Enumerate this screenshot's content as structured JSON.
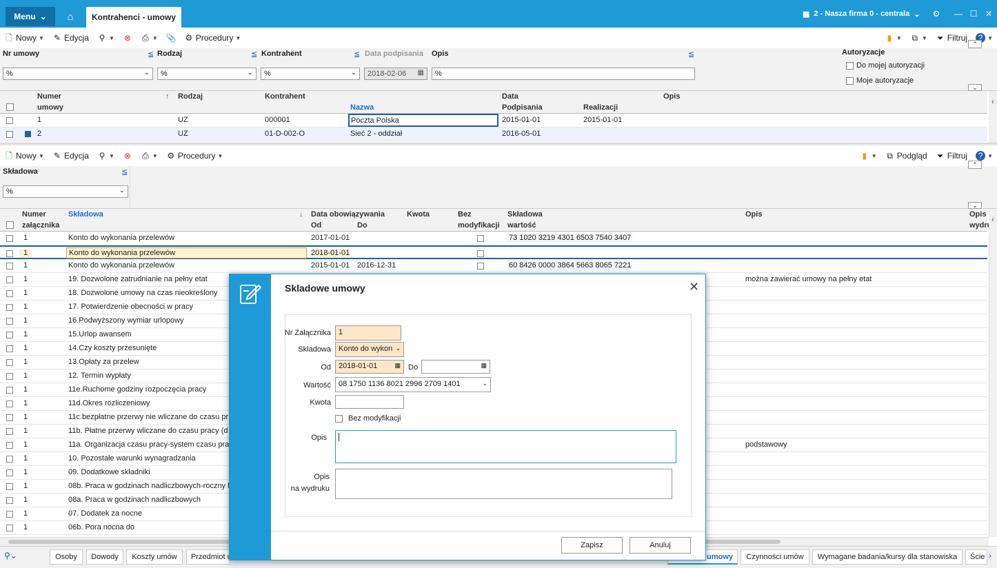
{
  "titlebar": {
    "menu_label": "Menu",
    "active_tab": "Kontrahenci - umowy",
    "company": "2 - Nasza firma 0 - centrala"
  },
  "toolbar1": {
    "new_label": "Nowy",
    "edit_label": "Edycja",
    "procedures_label": "Procedury",
    "filter_label": "Filtruj"
  },
  "filters1": {
    "nr_label": "Nr umowy",
    "rodzaj_label": "Rodzaj",
    "kontrahent_label": "Kontrahent",
    "data_label": "Data podpisania",
    "opis_label": "Opis",
    "nr_value": "%",
    "rodzaj_value": "%",
    "kontrahent_value": "%",
    "data_value": "2018-02-06",
    "opis_value": "%",
    "autoryzacje_label": "Autoryzacje",
    "do_mojej": "Do mojej autoryzacji",
    "moje": "Moje autoryzacje"
  },
  "grid1": {
    "h_numer": "Numer",
    "h_umowy": "umowy",
    "h_rodzaj": "Rodzaj",
    "h_kontrahent": "Kontrahent",
    "h_nazwa": "Nazwa",
    "h_data": "Data",
    "h_podpisania": "Podpisania",
    "h_realizacji": "Realizacji",
    "h_opis": "Opis",
    "rows": [
      {
        "numer": "1",
        "rodzaj": "UZ",
        "kontrahent": "000001",
        "nazwa": "Poczta Polska",
        "podpisania": "2015-01-01",
        "realizacji": "2015-01-01"
      },
      {
        "numer": "2",
        "rodzaj": "UZ",
        "kontrahent": "01-D-002-O",
        "nazwa": "Sieć 2 - oddział",
        "podpisania": "2016-05-01",
        "realizacji": ""
      }
    ]
  },
  "toolbar2": {
    "new_label": "Nowy",
    "edit_label": "Edycja",
    "procedures_label": "Procedury",
    "preview_label": "Podgląd",
    "filter_label": "Filtruj"
  },
  "filters2": {
    "skladowa_label": "Składowa",
    "skladowa_value": "%"
  },
  "grid2": {
    "h_numer": "Numer",
    "h_zalacznika": "załącznika",
    "h_skladowa": "Składowa",
    "h_data_obow": "Data obowiązywania",
    "h_od": "Od",
    "h_do": "Do",
    "h_kwota": "Kwota",
    "h_bez": "Bez",
    "h_modyfikacji": "modyfikacji",
    "h_skladowa2": "Składowa",
    "h_wartosc": "wartość",
    "h_opis": "Opis",
    "h_opis2": "Opis",
    "h_wydruk": "wydru",
    "rows": [
      {
        "numer": "1",
        "skladowa": "Konto do wykonania przelewów",
        "od": "2017-01-01",
        "do": "",
        "wartosc": "73 1020 3219 4301 6503 7540 3407",
        "opis": "",
        "bezcb": true
      },
      {
        "numer": "1",
        "skladowa": "Konto do wykonania przelewów",
        "od": "2018-01-01",
        "do": "",
        "wartosc": "",
        "opis": "",
        "bezcb": true
      },
      {
        "numer": "1",
        "skladowa": "Konto do wykonania przelewów",
        "od": "2015-01-01",
        "do": "2016-12-31",
        "wartosc": "60 8426 0000 3864 5663 8065 7221",
        "opis": "",
        "bezcb": true
      },
      {
        "numer": "1",
        "skladowa": "19. Dozwolone zatrudnianie na pełny etat",
        "od": "",
        "do": "",
        "wartosc": "",
        "opis": "można zawierać umowy na pełny etat",
        "bezcb": false
      },
      {
        "numer": "1",
        "skladowa": "18. Dozwolone umowy na czas nieokreślony",
        "od": "",
        "do": "",
        "wartosc": "",
        "opis": "",
        "bezcb": false
      },
      {
        "numer": "1",
        "skladowa": "17. Potwierdzenie obecności w pracy",
        "od": "",
        "do": "",
        "wartosc": "",
        "opis": "",
        "bezcb": false
      },
      {
        "numer": "1",
        "skladowa": "16.Podwyższony wymiar urlopowy",
        "od": "",
        "do": "",
        "wartosc": "",
        "opis": "",
        "bezcb": false
      },
      {
        "numer": "1",
        "skladowa": "15.Urlop awansem",
        "od": "",
        "do": "",
        "wartosc": "",
        "opis": "",
        "bezcb": false
      },
      {
        "numer": "1",
        "skladowa": "14.Czy koszty przesunięte",
        "od": "",
        "do": "",
        "wartosc": "",
        "opis": "",
        "bezcb": false
      },
      {
        "numer": "1",
        "skladowa": "13.Opłaty za przelew",
        "od": "",
        "do": "",
        "wartosc": "",
        "opis": "",
        "bezcb": false
      },
      {
        "numer": "1",
        "skladowa": "12. Termin wypłaty",
        "od": "",
        "do": "",
        "wartosc": "",
        "opis": "",
        "bezcb": false
      },
      {
        "numer": "1",
        "skladowa": "11e.Ruchome godziny rozpoczęcia pracy",
        "od": "",
        "do": "",
        "wartosc": "",
        "opis": "",
        "bezcb": false
      },
      {
        "numer": "1",
        "skladowa": "11d.Okres rozliczeniowy",
        "od": "",
        "do": "",
        "wartosc": "",
        "opis": "",
        "bezcb": false
      },
      {
        "numer": "1",
        "skladowa": "11c.bezpłatne przerwy nie wliczane do czasu pr",
        "od": "",
        "do": "",
        "wartosc": "",
        "opis": "",
        "bezcb": false
      },
      {
        "numer": "1",
        "skladowa": "11b. Płatne przerwy wliczane do czasu pracy (d",
        "od": "",
        "do": "",
        "wartosc": "",
        "opis": "",
        "bezcb": false
      },
      {
        "numer": "1",
        "skladowa": "11a. Organizacja czasu pracy-system czasu prac",
        "od": "",
        "do": "",
        "wartosc": "",
        "opis": "podstawowy",
        "bezcb": false
      },
      {
        "numer": "1",
        "skladowa": "10. Pozostałe warunki wynagradzania",
        "od": "",
        "do": "",
        "wartosc": "",
        "opis": "",
        "bezcb": false
      },
      {
        "numer": "1",
        "skladowa": "09. Dodatkowe składniki",
        "od": "",
        "do": "",
        "wartosc": "",
        "opis": "",
        "bezcb": false
      },
      {
        "numer": "1",
        "skladowa": "08b. Praca w godzinach nadliczbowych-roczny l",
        "od": "",
        "do": "",
        "wartosc": "",
        "opis": "",
        "bezcb": false
      },
      {
        "numer": "1",
        "skladowa": "08a. Praca w godzinach nadliczbowych",
        "od": "",
        "do": "",
        "wartosc": "",
        "opis": "",
        "bezcb": false
      },
      {
        "numer": "1",
        "skladowa": "07. Dodatek za nocne",
        "od": "",
        "do": "",
        "wartosc": "",
        "opis": "",
        "bezcb": false
      },
      {
        "numer": "1",
        "skladowa": "06b. Pora nocna do",
        "od": "",
        "do": "",
        "wartosc": "",
        "opis": "",
        "bezcb": false
      }
    ]
  },
  "modal": {
    "title": "Skladowe umowy",
    "nr_label": "Nr Załącznika",
    "nr_value": "1",
    "skladowa_label": "Skladowa",
    "skladowa_value": "Konto do wykon",
    "od_label": "Od",
    "od_value": "2018-01-01",
    "do_label": "Do",
    "do_value": "",
    "wartosc_label": "Wartość",
    "wartosc_value": "08 1750 1136 8021 2996 2709 1401",
    "kwota_label": "Kwota",
    "kwota_value": "",
    "bez_label": "Bez modyfikacji",
    "opis_label": "Opis",
    "opis_wydruk_label1": "Opis",
    "opis_wydruk_label2": "na wydruku",
    "save_label": "Zapisz",
    "cancel_label": "Anuluj"
  },
  "bottom_tabs": [
    "Osoby",
    "Dowody",
    "Koszty umów",
    "Przedmiot u",
    "umowy",
    "Czynności umów",
    "Wymagane badania/kursy dla stanowiska",
    "Ście"
  ]
}
